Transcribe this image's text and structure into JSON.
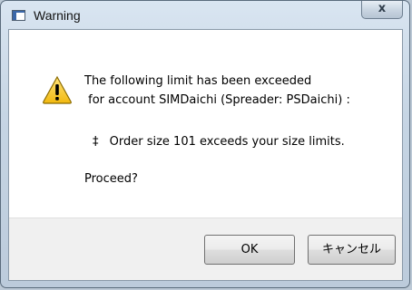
{
  "window": {
    "title": "Warning",
    "close_label": "x"
  },
  "message": {
    "line1": "The following limit has been exceeded",
    "line2": " for account SIMDaichi (Spreader: PSDaichi) :",
    "bullet": "‡",
    "item": "Order size 101 exceeds your size limits.",
    "prompt": "Proceed?"
  },
  "buttons": {
    "ok": "OK",
    "cancel": "キャンセル"
  },
  "icons": {
    "app": "window-icon",
    "warning": "warning-icon"
  },
  "colors": {
    "warning_fill": "#f5c51f",
    "warning_stroke": "#8a6a00",
    "client_bg": "#ffffff",
    "footer_bg": "#f0f0f0"
  }
}
